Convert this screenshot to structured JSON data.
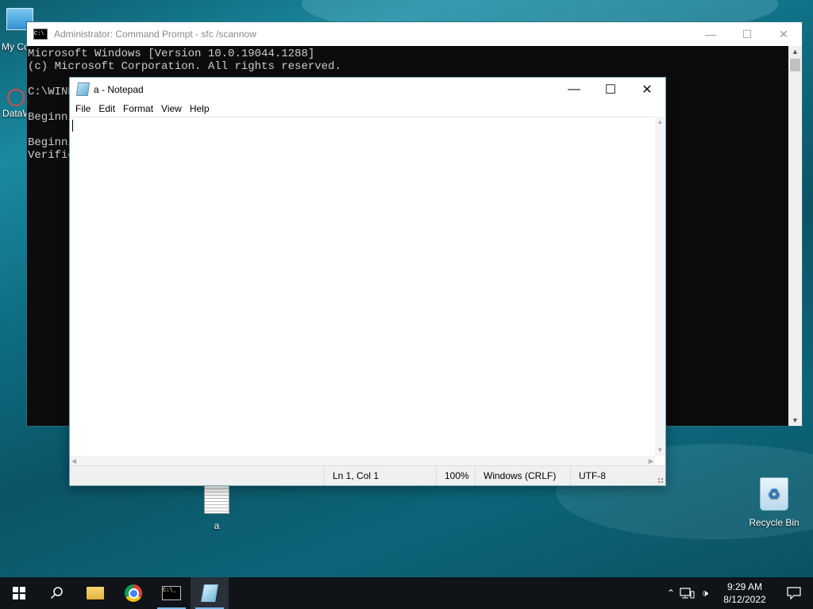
{
  "desktop": {
    "icons": [
      {
        "label": "My Co"
      },
      {
        "label": "DataW"
      },
      {
        "label": "a"
      },
      {
        "label": "Recycle Bin"
      }
    ]
  },
  "cmd": {
    "title": "Administrator: Command Prompt - sfc /scannow",
    "lines": [
      "Microsoft Windows [Version 10.0.19044.1288]",
      "(c) Microsoft Corporation. All rights reserved.",
      "",
      "C:\\WIND",
      "",
      "Beginni",
      "",
      "Beginni",
      "Verific"
    ]
  },
  "notepad": {
    "title": "a - Notepad",
    "menu": [
      "File",
      "Edit",
      "Format",
      "View",
      "Help"
    ],
    "content": "",
    "status": {
      "position": "Ln 1, Col 1",
      "zoom": "100%",
      "line_ending": "Windows (CRLF)",
      "encoding": "UTF-8"
    }
  },
  "taskbar": {
    "time": "9:29 AM",
    "date": "8/12/2022"
  }
}
